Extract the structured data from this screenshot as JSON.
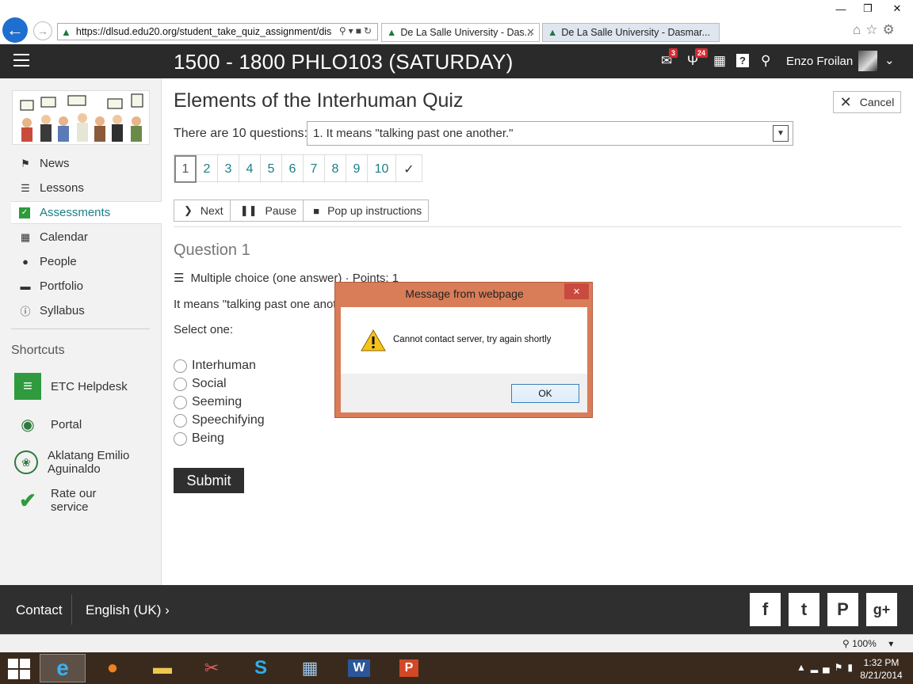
{
  "browser": {
    "url": "https://dlsud.edu20.org/student_take_quiz_assignment/dis",
    "tabs": [
      {
        "title": "De La Salle University - Das..."
      },
      {
        "title": "De La Salle University - Dasmar..."
      }
    ],
    "window_controls": [
      "minimize-icon",
      "restore-icon",
      "close-icon"
    ]
  },
  "header": {
    "course_title": "1500 - 1800 PHLO103 (SATURDAY)",
    "messages_badge": "3",
    "alerts_badge": "24",
    "user_name": "Enzo Froilan"
  },
  "sidebar": {
    "nav": [
      {
        "label": "News",
        "icon": "bell-icon"
      },
      {
        "label": "Lessons",
        "icon": "list-icon"
      },
      {
        "label": "Assessments",
        "icon": "check-icon",
        "active": true
      },
      {
        "label": "Calendar",
        "icon": "calendar-icon"
      },
      {
        "label": "People",
        "icon": "person-icon"
      },
      {
        "label": "Portfolio",
        "icon": "folder-icon"
      },
      {
        "label": "Syllabus",
        "icon": "info-icon"
      }
    ],
    "shortcuts_heading": "Shortcuts",
    "shortcuts": [
      {
        "line1": "ETC Helpdesk",
        "line2": ""
      },
      {
        "line1": "Portal",
        "line2": ""
      },
      {
        "line1": "Aklatang Emilio",
        "line2": "Aguinaldo"
      },
      {
        "line1": "Rate our",
        "line2": "service"
      }
    ]
  },
  "quiz": {
    "title": "Elements of the Interhuman Quiz",
    "cancel_label": "Cancel",
    "question_count_label": "There are 10 questions:",
    "selected_question": "1. It means \"talking past one another.\"",
    "pages": [
      "1",
      "2",
      "3",
      "4",
      "5",
      "6",
      "7",
      "8",
      "9",
      "10"
    ],
    "current_page": 1,
    "toolbar": {
      "next": "Next",
      "pause": "Pause",
      "popup": "Pop up instructions"
    },
    "question_heading": "Question 1",
    "question_type": "Multiple choice (one answer) · Points: 1",
    "question_text": "It means \"talking past one another.\"",
    "select_one": "Select one:",
    "options": [
      "Interhuman",
      "Social",
      "Seeming",
      "Speechifying",
      "Being"
    ],
    "submit_label": "Submit"
  },
  "dialog": {
    "title": "Message from webpage",
    "message": "Cannot contact server, try again shortly",
    "ok_label": "OK"
  },
  "footer": {
    "contact": "Contact",
    "language": "English (UK)",
    "social": [
      "facebook-icon",
      "twitter-icon",
      "pinterest-icon",
      "google-plus-icon"
    ]
  },
  "statusbar": {
    "zoom": "100%"
  },
  "taskbar": {
    "time": "1:32 PM",
    "date": "8/21/2014"
  },
  "colors": {
    "header_bg": "#2a2a2a",
    "accent_teal": "#1a7f86",
    "dialog_frame": "#d97d58",
    "footer_bg": "#2f2f2f"
  }
}
